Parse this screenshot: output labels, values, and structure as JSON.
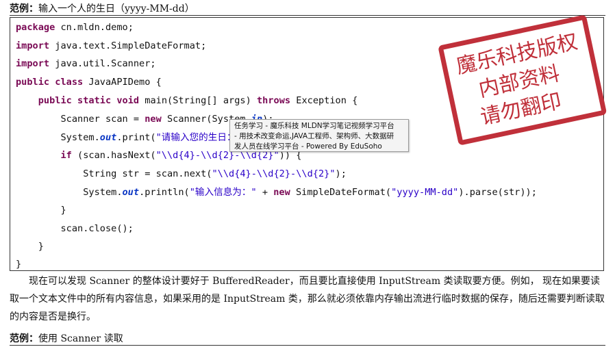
{
  "heading1": {
    "label": "范例：",
    "text": "输入一个人的生日（yyyy-MM-dd）"
  },
  "code_lines": [
    [
      [
        "kw",
        "package"
      ],
      [
        "t",
        " cn.mldn.demo;"
      ]
    ],
    [
      [
        "kw",
        "import"
      ],
      [
        "t",
        " java.text.SimpleDateFormat;"
      ]
    ],
    [
      [
        "kw",
        "import"
      ],
      [
        "t",
        " java.util.Scanner;"
      ]
    ],
    [
      [
        "kw",
        "public"
      ],
      [
        "t",
        " "
      ],
      [
        "kw",
        "class"
      ],
      [
        "t",
        " JavaAPIDemo {"
      ]
    ],
    [
      [
        "t",
        "    "
      ],
      [
        "kw",
        "public"
      ],
      [
        "t",
        " "
      ],
      [
        "kw",
        "static"
      ],
      [
        "t",
        " "
      ],
      [
        "kw",
        "void"
      ],
      [
        "t",
        " main(String[] args) "
      ],
      [
        "kw",
        "throws"
      ],
      [
        "t",
        " Exception {"
      ]
    ],
    [
      [
        "t",
        "        Scanner scan = "
      ],
      [
        "kw",
        "new"
      ],
      [
        "t",
        " Scanner(System."
      ],
      [
        "fld",
        "in"
      ],
      [
        "t",
        ");"
      ]
    ],
    [
      [
        "t",
        "        System."
      ],
      [
        "fld",
        "out"
      ],
      [
        "t",
        ".print("
      ],
      [
        "str",
        "\"请输入您的生日：\""
      ],
      [
        "t",
        ");"
      ]
    ],
    [
      [
        "t",
        "        "
      ],
      [
        "kw",
        "if"
      ],
      [
        "t",
        " (scan.hasNext("
      ],
      [
        "str",
        "\"\\\\d{4}-\\\\d{2}-\\\\d{2}\""
      ],
      [
        "t",
        ")) {"
      ]
    ],
    [
      [
        "t",
        "            String str = scan.next("
      ],
      [
        "str",
        "\"\\\\d{4}-\\\\d{2}-\\\\d{2}\""
      ],
      [
        "t",
        ");"
      ]
    ],
    [
      [
        "t",
        "            System."
      ],
      [
        "fld",
        "out"
      ],
      [
        "t",
        ".println("
      ],
      [
        "str",
        "\"输入信息为：\""
      ],
      [
        "t",
        " + "
      ],
      [
        "kw",
        "new"
      ],
      [
        "t",
        " SimpleDateFormat("
      ],
      [
        "str",
        "\"yyyy-MM-dd\""
      ],
      [
        "t",
        ").parse(str));"
      ]
    ],
    [
      [
        "t",
        "        }"
      ]
    ],
    [
      [
        "t",
        "        scan.close();"
      ]
    ],
    [
      [
        "t",
        "    }"
      ]
    ],
    [
      [
        "t",
        "}"
      ]
    ]
  ],
  "paragraph": "现在可以发现 Scanner 的整体设计要好于 BufferedReader，而且要比直接使用 InputStream 类读取要方便。例如， 现在如果要读取一个文本文件中的所有内容信息，如果采用的是 InputStream 类，那么就必须依靠内存输出流进行临时数据的保存，随后还需要判断读取的内容是否是换行。",
  "heading2": {
    "label": "范例：",
    "text": "使用 Scanner 读取"
  },
  "watermark": {
    "line1": "魔乐科技版权",
    "line2": "内部资料",
    "line3": "请勿翻印",
    "color": "#c0303a"
  },
  "tooltip": {
    "line1": "任务学习 - 魔乐科技 MLDN学习笔记视频学习平台",
    "line2": "- 用技术改变命运,JAVA工程师、架构师、大数据研",
    "line3": "发人员在线学习平台 - Powered By EduSoho"
  }
}
